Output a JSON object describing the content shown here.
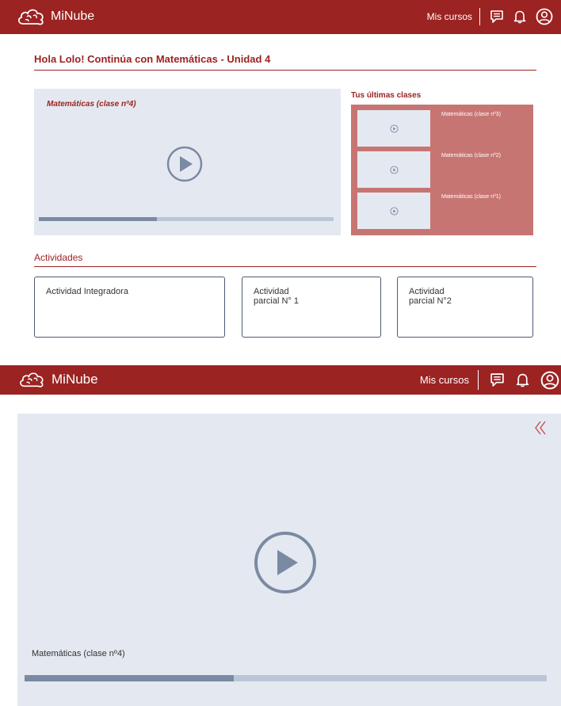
{
  "colors": {
    "brand": "#9b2321",
    "panel": "#e4e9f1",
    "list_panel": "#c77573",
    "progress_fill": "#7b8aa3",
    "progress_track": "#bac6d8"
  },
  "header": {
    "brand": "MiNube",
    "mis_cursos": "Mis cursos",
    "icons": [
      "cloud-logo-icon",
      "chat-icon",
      "bell-icon",
      "user-icon"
    ]
  },
  "dashboard": {
    "greeting": "Hola Lolo! Continúa con Matemáticas - Unidad 4",
    "current_video": {
      "title": "Matemáticas (clase nº4)",
      "progress": 0.4
    },
    "recent": {
      "title": "Tus últimas clases",
      "items": [
        {
          "label": "Matemáticas (clase nº3)"
        },
        {
          "label": "Matemáticas (clase nº2)"
        },
        {
          "label": "Matemáticas (clase nº1)"
        }
      ]
    },
    "activities": {
      "title": "Actividades",
      "items": [
        {
          "label": "Actividad Integradora"
        },
        {
          "label": "Actividad\nparcial N° 1"
        },
        {
          "label": "Actividad\nparcial N°2"
        }
      ]
    }
  },
  "player": {
    "title": "Matemáticas (clase nº4)",
    "progress": 0.4,
    "collapse_icon": "double-chevron-left-icon"
  }
}
